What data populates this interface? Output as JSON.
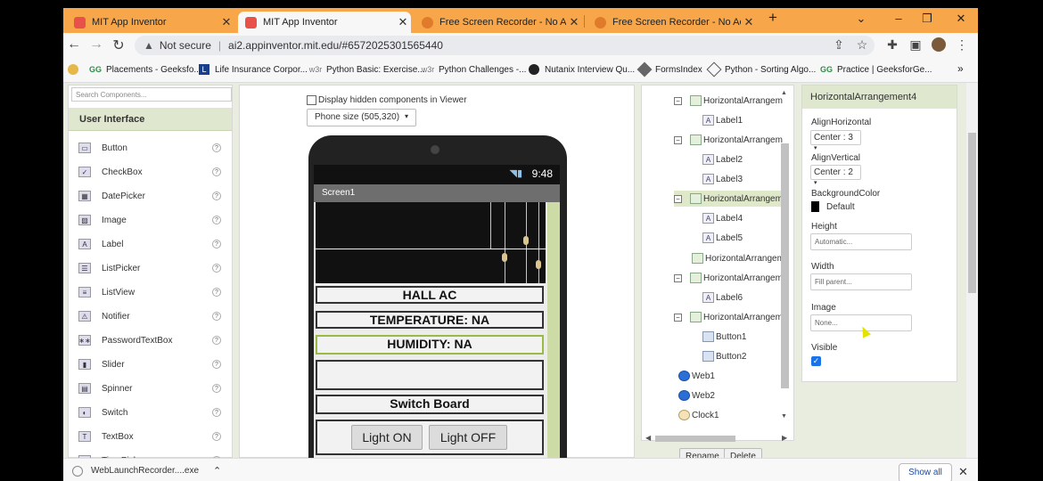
{
  "browser": {
    "tabs": [
      {
        "title": "MIT App Inventor",
        "favicon_color": "#e8514a"
      },
      {
        "title": "MIT App Inventor",
        "favicon_color": "#e8514a"
      },
      {
        "title": "Free Screen Recorder - No Account",
        "favicon_color": "#e07b2c"
      },
      {
        "title": "Free Screen Recorder - No Account",
        "favicon_color": "#e07b2c"
      }
    ],
    "new_tab": "+",
    "window_controls": {
      "chevron": "⌄",
      "minimize": "–",
      "maximize": "❐",
      "close": "✕"
    },
    "security": "Not secure",
    "url": "ai2.appinventor.mit.edu/#6572025301565440",
    "bookmarks": [
      "Placements - Geeksfo...",
      "Life Insurance Corpor...",
      "Python Basic: Exercise...",
      "Python Challenges -...",
      "Nutanix Interview Qu...",
      "FormsIndex",
      "Python - Sorting Algo...",
      "Practice | GeeksforGe..."
    ],
    "bookmarks_more": "»"
  },
  "palette": {
    "search_placeholder": "Search Components...",
    "section": "User Interface",
    "items": [
      "Button",
      "CheckBox",
      "DatePicker",
      "Image",
      "Label",
      "ListPicker",
      "ListView",
      "Notifier",
      "PasswordTextBox",
      "Slider",
      "Spinner",
      "Switch",
      "TextBox",
      "TimePicker"
    ],
    "help": "?"
  },
  "viewer": {
    "hidden_components": "Display hidden components in Viewer",
    "phone_size": "Phone size (505,320)",
    "status_time": "9:48",
    "screen_title": "Screen1",
    "labels": [
      "HALL AC",
      "TEMPERATURE:  NA",
      "HUMIDITY:  NA",
      "Switch Board"
    ],
    "buttons": [
      "Light ON",
      "Light OFF"
    ]
  },
  "tree": {
    "nodes": [
      {
        "text": "HorizontalArrangem",
        "type": "arr",
        "level": 0
      },
      {
        "text": "Label1",
        "type": "lab",
        "level": 1
      },
      {
        "text": "HorizontalArrangem",
        "type": "arr",
        "level": 0
      },
      {
        "text": "Label2",
        "type": "lab",
        "level": 1
      },
      {
        "text": "Label3",
        "type": "lab",
        "level": 1
      },
      {
        "text": "HorizontalArrangem",
        "type": "arr",
        "level": 0,
        "selected": true
      },
      {
        "text": "Label4",
        "type": "lab",
        "level": 1
      },
      {
        "text": "Label5",
        "type": "lab",
        "level": 1
      },
      {
        "text": "HorizontalArrangem",
        "type": "arr",
        "level": 0,
        "noexpand": true
      },
      {
        "text": "HorizontalArrangem",
        "type": "arr",
        "level": 0
      },
      {
        "text": "Label6",
        "type": "lab",
        "level": 1
      },
      {
        "text": "HorizontalArrangem",
        "type": "arr",
        "level": 0
      },
      {
        "text": "Button1",
        "type": "btn",
        "level": 1
      },
      {
        "text": "Button2",
        "type": "btn",
        "level": 1
      },
      {
        "text": "Web1",
        "type": "web",
        "level": -1
      },
      {
        "text": "Web2",
        "type": "web",
        "level": -1
      },
      {
        "text": "Clock1",
        "type": "clk",
        "level": -1
      }
    ],
    "rename": "Rename",
    "delete": "Delete"
  },
  "properties": {
    "title": "HorizontalArrangement4",
    "align_horizontal_label": "AlignHorizontal",
    "align_horizontal_value": "Center : 3",
    "align_vertical_label": "AlignVertical",
    "align_vertical_value": "Center : 2",
    "background_label": "BackgroundColor",
    "background_value": "Default",
    "background_color": "#000000",
    "height_label": "Height",
    "height_value": "Automatic...",
    "width_label": "Width",
    "width_value": "Fill parent...",
    "image_label": "Image",
    "image_value": "None...",
    "visible_label": "Visible",
    "visible_checked": true
  },
  "download": {
    "file": "WebLaunchRecorder....exe",
    "show_all": "Show all"
  },
  "colors": {
    "tab_bar": "#f8a64a",
    "panel_header": "#dfe8cf",
    "selection": "#dfe8c8"
  }
}
